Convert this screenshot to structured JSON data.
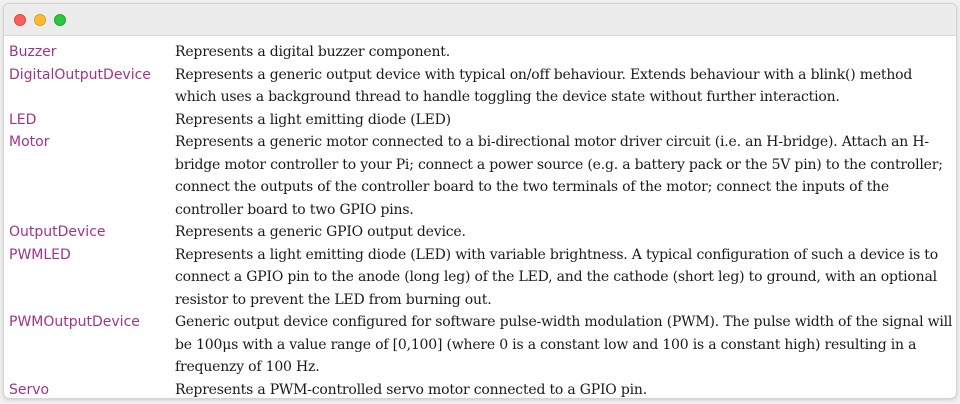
{
  "window": {
    "buttons": {
      "close": "close",
      "minimize": "minimize",
      "maximize": "maximize"
    }
  },
  "rows": [
    {
      "name": "Buzzer",
      "desc": "Represents a digital buzzer component."
    },
    {
      "name": "DigitalOutputDevice",
      "desc": "Represents a generic output device with typical on/off behaviour. Extends behaviour with a blink() method which uses a background thread to handle toggling the device state without further interaction."
    },
    {
      "name": "LED",
      "desc": "Represents a light emitting diode (LED)"
    },
    {
      "name": "Motor",
      "desc": "Represents a generic motor connected to a bi-directional motor driver circuit (i.e. an H-bridge). Attach an H-bridge motor controller to your Pi; connect a power source (e.g. a battery pack or the 5V pin) to the controller; connect the outputs of the controller board to the two terminals of the motor; connect the inputs of the controller board to two GPIO pins."
    },
    {
      "name": "OutputDevice",
      "desc": "Represents a generic GPIO output device."
    },
    {
      "name": "PWMLED",
      "desc": "Represents a light emitting diode (LED) with variable brightness. A typical configuration of such a device is to connect a GPIO pin to the anode (long leg) of the LED, and the cathode (short leg) to ground, with an optional resistor to prevent the LED from burning out."
    },
    {
      "name": "PWMOutputDevice",
      "desc": "Generic output device configured for software pulse-width modulation (PWM). The pulse width of the signal will be 100μs with a value range of [0,100] (where 0 is a constant low and 100 is a constant high) resulting in a frequenzy of 100 Hz."
    },
    {
      "name": "Servo",
      "desc": "Represents a PWM-controlled servo motor connected to a GPIO pin."
    }
  ],
  "colors": {
    "name": "#a0348c",
    "text": "#1a1a1a",
    "titlebar": "#ececec"
  }
}
